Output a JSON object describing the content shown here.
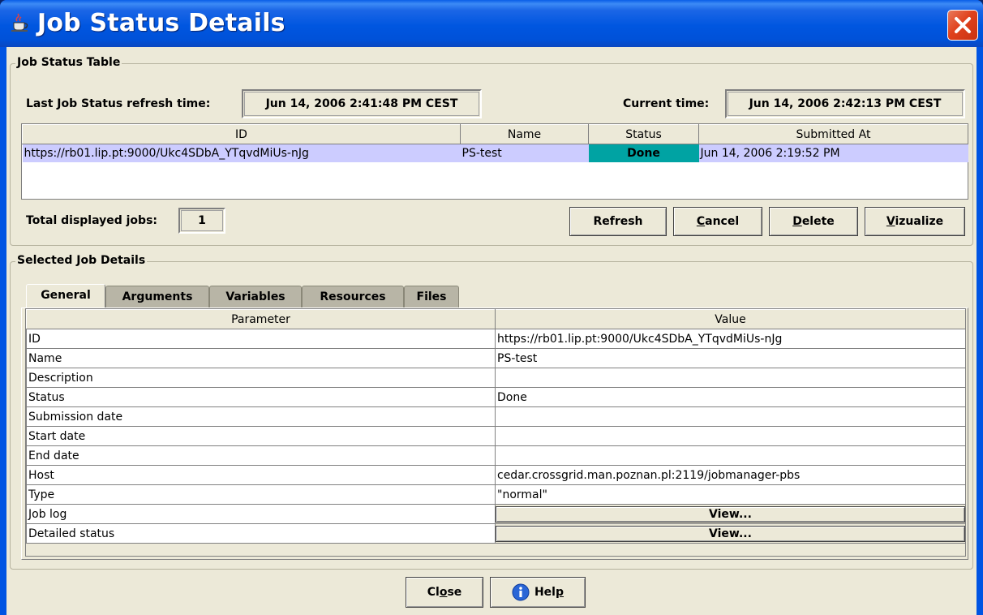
{
  "window": {
    "title": "Job Status Details"
  },
  "job_status_table": {
    "group_title": "Job Status Table",
    "last_refresh_label": "Last Job Status refresh time:",
    "last_refresh_value": "Jun 14, 2006 2:41:48 PM CEST",
    "current_time_label": "Current time:",
    "current_time_value": "Jun 14, 2006 2:42:13 PM CEST",
    "columns": [
      "ID",
      "Name",
      "Status",
      "Submitted At"
    ],
    "rows": [
      {
        "id": "https://rb01.lip.pt:9000/Ukc4SDbA_YTqvdMiUs-nJg",
        "name": "PS-test",
        "status": "Done",
        "submitted": "Jun 14, 2006 2:19:52 PM"
      }
    ],
    "total_label": "Total displayed jobs:",
    "total_value": "1",
    "buttons": {
      "refresh": "Refresh",
      "cancel_first": "C",
      "cancel_rest": "ancel",
      "delete_first": "D",
      "delete_rest": "elete",
      "vizualize_first": "V",
      "vizualize_rest": "izualize"
    }
  },
  "selected_job": {
    "group_title": "Selected Job Details",
    "tabs": [
      "General",
      "Arguments",
      "Variables",
      "Resources",
      "Files"
    ],
    "active_tab": "General",
    "columns": [
      "Parameter",
      "Value"
    ],
    "rows": [
      {
        "param": "ID",
        "value": "https://rb01.lip.pt:9000/Ukc4SDbA_YTqvdMiUs-nJg"
      },
      {
        "param": "Name",
        "value": "PS-test"
      },
      {
        "param": "Description",
        "value": ""
      },
      {
        "param": "Status",
        "value": "Done"
      },
      {
        "param": "Submission date",
        "value": ""
      },
      {
        "param": "Start date",
        "value": ""
      },
      {
        "param": "End date",
        "value": ""
      },
      {
        "param": "Host",
        "value": "cedar.crossgrid.man.poznan.pl:2119/jobmanager-pbs"
      },
      {
        "param": "Type",
        "value": "\"normal\""
      },
      {
        "param": "Job log",
        "value": "View..."
      },
      {
        "param": "Detailed status",
        "value": "View..."
      }
    ]
  },
  "footer": {
    "close_first": "Cl",
    "close_u": "o",
    "close_rest": "se",
    "help_first": "Hel",
    "help_u": "p"
  },
  "colors": {
    "titlebar": "#0054e3",
    "selected_row": "#ccccff",
    "status_done": "#00a3a3",
    "dialog_bg": "#ece9d8",
    "close_button": "#e0421d"
  },
  "icons": {
    "title": "java-cup-icon",
    "close": "close-icon",
    "help": "info-icon"
  }
}
